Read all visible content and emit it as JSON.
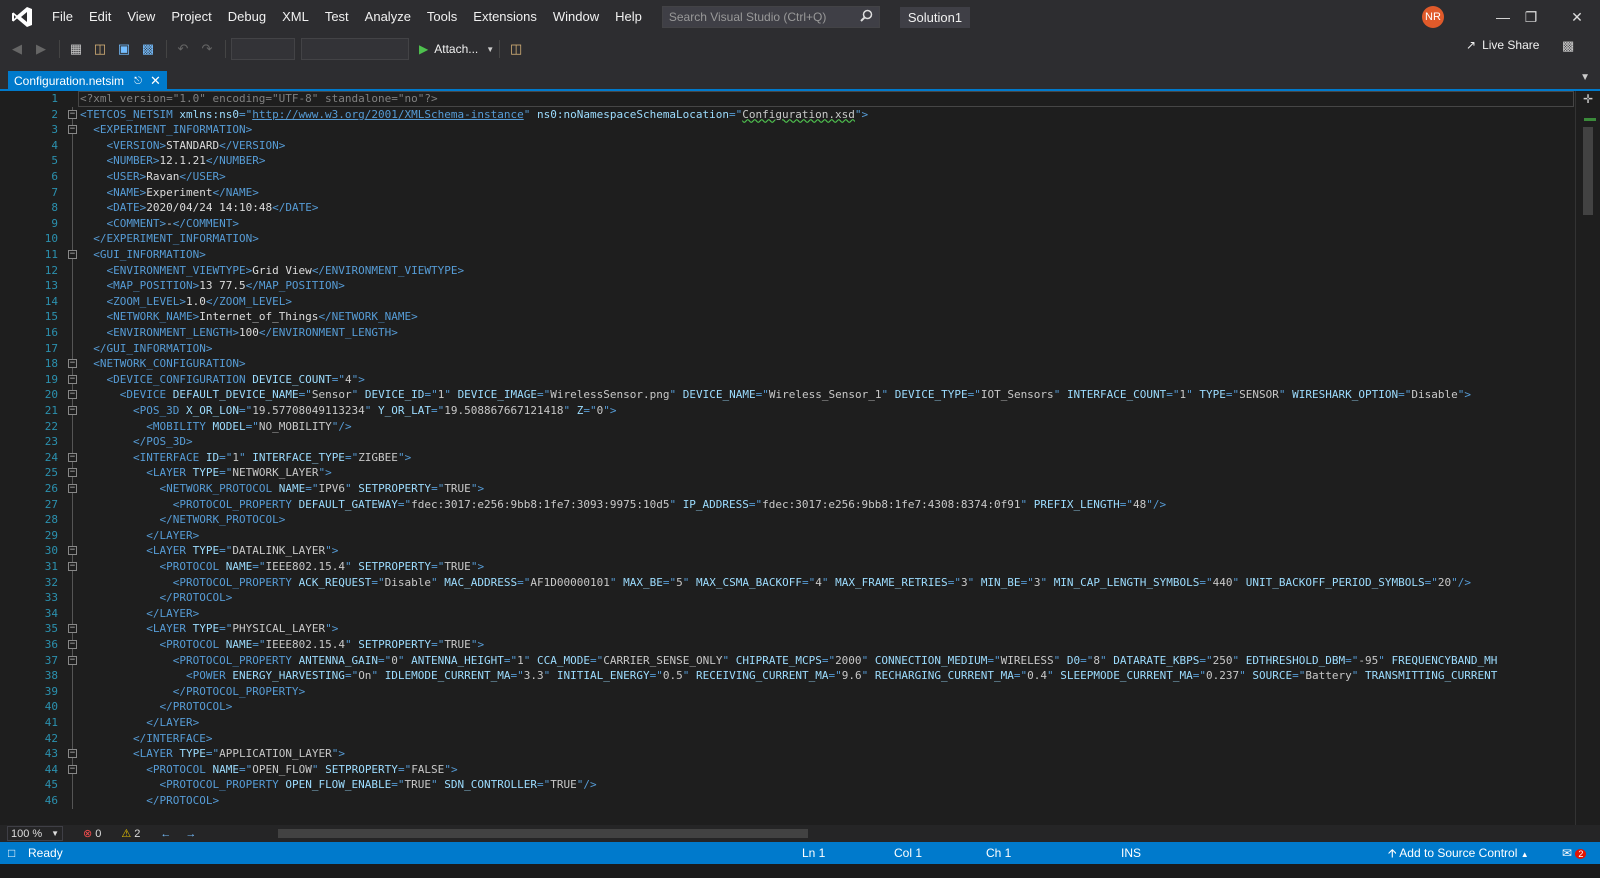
{
  "menu": [
    "File",
    "Edit",
    "View",
    "Project",
    "Debug",
    "XML",
    "Test",
    "Analyze",
    "Tools",
    "Extensions",
    "Window",
    "Help"
  ],
  "search": {
    "placeholder": "Search Visual Studio (Ctrl+Q)"
  },
  "solution_name": "Solution1",
  "user_initials": "NR",
  "toolbar": {
    "attach_label": "Attach...",
    "live_share_label": "Live Share"
  },
  "tab": {
    "title": "Configuration.netsim"
  },
  "editor": {
    "lines": [
      {
        "n": "1",
        "text": "<?xml version=\"1.0\" encoding=\"UTF-8\" standalone=\"no\"?>",
        "fold": ""
      },
      {
        "n": "2",
        "text": "<TETCOS_NETSIM xmlns:ns0=\"http://www.w3.org/2001/XMLSchema-instance\" ns0:noNamespaceSchemaLocation=\"Configuration.xsd\">",
        "fold": "minus"
      },
      {
        "n": "3",
        "text": "  <EXPERIMENT_INFORMATION>",
        "fold": "minus"
      },
      {
        "n": "4",
        "text": "    <VERSION>STANDARD</VERSION>",
        "fold": ""
      },
      {
        "n": "5",
        "text": "    <NUMBER>12.1.21</NUMBER>",
        "fold": ""
      },
      {
        "n": "6",
        "text": "    <USER>Ravan</USER>",
        "fold": ""
      },
      {
        "n": "7",
        "text": "    <NAME>Experiment</NAME>",
        "fold": ""
      },
      {
        "n": "8",
        "text": "    <DATE>2020/04/24 14:10:48</DATE>",
        "fold": ""
      },
      {
        "n": "9",
        "text": "    <COMMENT>-</COMMENT>",
        "fold": ""
      },
      {
        "n": "10",
        "text": "  </EXPERIMENT_INFORMATION>",
        "fold": ""
      },
      {
        "n": "11",
        "text": "  <GUI_INFORMATION>",
        "fold": "minus"
      },
      {
        "n": "12",
        "text": "    <ENVIRONMENT_VIEWTYPE>Grid View</ENVIRONMENT_VIEWTYPE>",
        "fold": ""
      },
      {
        "n": "13",
        "text": "    <MAP_POSITION>13 77.5</MAP_POSITION>",
        "fold": ""
      },
      {
        "n": "14",
        "text": "    <ZOOM_LEVEL>1.0</ZOOM_LEVEL>",
        "fold": ""
      },
      {
        "n": "15",
        "text": "    <NETWORK_NAME>Internet_of_Things</NETWORK_NAME>",
        "fold": ""
      },
      {
        "n": "16",
        "text": "    <ENVIRONMENT_LENGTH>100</ENVIRONMENT_LENGTH>",
        "fold": ""
      },
      {
        "n": "17",
        "text": "  </GUI_INFORMATION>",
        "fold": ""
      },
      {
        "n": "18",
        "text": "  <NETWORK_CONFIGURATION>",
        "fold": "minus"
      },
      {
        "n": "19",
        "text": "    <DEVICE_CONFIGURATION DEVICE_COUNT=\"4\">",
        "fold": "minus"
      },
      {
        "n": "20",
        "text": "      <DEVICE DEFAULT_DEVICE_NAME=\"Sensor\" DEVICE_ID=\"1\" DEVICE_IMAGE=\"WirelessSensor.png\" DEVICE_NAME=\"Wireless_Sensor_1\" DEVICE_TYPE=\"IOT_Sensors\" INTERFACE_COUNT=\"1\" TYPE=\"SENSOR\" WIRESHARK_OPTION=\"Disable\">",
        "fold": "minus"
      },
      {
        "n": "21",
        "text": "        <POS_3D X_OR_LON=\"19.57708049113234\" Y_OR_LAT=\"19.508867667121418\" Z=\"0\">",
        "fold": "minus"
      },
      {
        "n": "22",
        "text": "          <MOBILITY MODEL=\"NO_MOBILITY\"/>",
        "fold": ""
      },
      {
        "n": "23",
        "text": "        </POS_3D>",
        "fold": ""
      },
      {
        "n": "24",
        "text": "        <INTERFACE ID=\"1\" INTERFACE_TYPE=\"ZIGBEE\">",
        "fold": "minus"
      },
      {
        "n": "25",
        "text": "          <LAYER TYPE=\"NETWORK_LAYER\">",
        "fold": "minus"
      },
      {
        "n": "26",
        "text": "            <NETWORK_PROTOCOL NAME=\"IPV6\" SETPROPERTY=\"TRUE\">",
        "fold": "minus"
      },
      {
        "n": "27",
        "text": "              <PROTOCOL_PROPERTY DEFAULT_GATEWAY=\"fdec:3017:e256:9bb8:1fe7:3093:9975:10d5\" IP_ADDRESS=\"fdec:3017:e256:9bb8:1fe7:4308:8374:0f91\" PREFIX_LENGTH=\"48\"/>",
        "fold": ""
      },
      {
        "n": "28",
        "text": "            </NETWORK_PROTOCOL>",
        "fold": ""
      },
      {
        "n": "29",
        "text": "          </LAYER>",
        "fold": ""
      },
      {
        "n": "30",
        "text": "          <LAYER TYPE=\"DATALINK_LAYER\">",
        "fold": "minus"
      },
      {
        "n": "31",
        "text": "            <PROTOCOL NAME=\"IEEE802.15.4\" SETPROPERTY=\"TRUE\">",
        "fold": "minus"
      },
      {
        "n": "32",
        "text": "              <PROTOCOL_PROPERTY ACK_REQUEST=\"Disable\" MAC_ADDRESS=\"AF1D00000101\" MAX_BE=\"5\" MAX_CSMA_BACKOFF=\"4\" MAX_FRAME_RETRIES=\"3\" MIN_BE=\"3\" MIN_CAP_LENGTH_SYMBOLS=\"440\" UNIT_BACKOFF_PERIOD_SYMBOLS=\"20\"/>",
        "fold": ""
      },
      {
        "n": "33",
        "text": "            </PROTOCOL>",
        "fold": ""
      },
      {
        "n": "34",
        "text": "          </LAYER>",
        "fold": ""
      },
      {
        "n": "35",
        "text": "          <LAYER TYPE=\"PHYSICAL_LAYER\">",
        "fold": "minus"
      },
      {
        "n": "36",
        "text": "            <PROTOCOL NAME=\"IEEE802.15.4\" SETPROPERTY=\"TRUE\">",
        "fold": "minus"
      },
      {
        "n": "37",
        "text": "              <PROTOCOL_PROPERTY ANTENNA_GAIN=\"0\" ANTENNA_HEIGHT=\"1\" CCA_MODE=\"CARRIER_SENSE_ONLY\" CHIPRATE_MCPS=\"2000\" CONNECTION_MEDIUM=\"WIRELESS\" D0=\"8\" DATARATE_KBPS=\"250\" EDTHRESHOLD_DBM=\"-95\" FREQUENCYBAND_MH",
        "fold": "minus"
      },
      {
        "n": "38",
        "text": "                <POWER ENERGY_HARVESTING=\"On\" IDLEMODE_CURRENT_MA=\"3.3\" INITIAL_ENERGY=\"0.5\" RECEIVING_CURRENT_MA=\"9.6\" RECHARGING_CURRENT_MA=\"0.4\" SLEEPMODE_CURRENT_MA=\"0.237\" SOURCE=\"Battery\" TRANSMITTING_CURRENT",
        "fold": ""
      },
      {
        "n": "39",
        "text": "              </PROTOCOL_PROPERTY>",
        "fold": ""
      },
      {
        "n": "40",
        "text": "            </PROTOCOL>",
        "fold": ""
      },
      {
        "n": "41",
        "text": "          </LAYER>",
        "fold": ""
      },
      {
        "n": "42",
        "text": "        </INTERFACE>",
        "fold": ""
      },
      {
        "n": "43",
        "text": "        <LAYER TYPE=\"APPLICATION_LAYER\">",
        "fold": "minus"
      },
      {
        "n": "44",
        "text": "          <PROTOCOL NAME=\"OPEN_FLOW\" SETPROPERTY=\"FALSE\">",
        "fold": "minus"
      },
      {
        "n": "45",
        "text": "            <PROTOCOL_PROPERTY OPEN_FLOW_ENABLE=\"TRUE\" SDN_CONTROLLER=\"TRUE\"/>",
        "fold": ""
      },
      {
        "n": "46",
        "text": "          </PROTOCOL>",
        "fold": ""
      }
    ]
  },
  "bottom": {
    "zoom": "100 %",
    "errors": "0",
    "warnings": "2"
  },
  "status": {
    "ready": "Ready",
    "ln": "Ln 1",
    "col": "Col 1",
    "ch": "Ch 1",
    "ins": "INS",
    "source_control": "Add to Source Control",
    "notifications": "2"
  },
  "colors": {
    "accent": "#007acc",
    "tag": "#569cd6",
    "attr_name": "#9cdcfe",
    "attr_value": "#c8c8c8",
    "quote": "#569cd6",
    "pi": "#808080",
    "url": "#569cd6"
  }
}
